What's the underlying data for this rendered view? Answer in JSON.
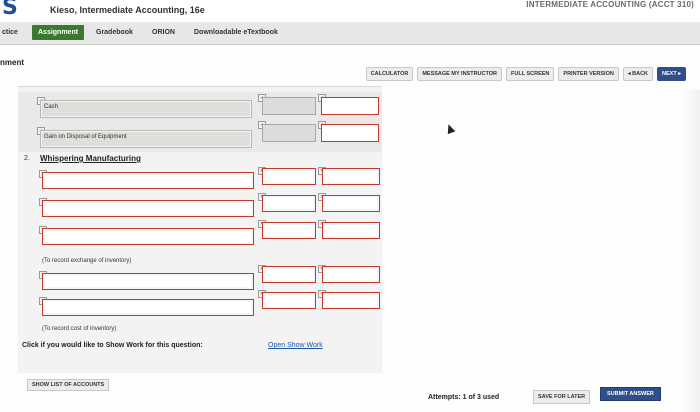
{
  "header": {
    "logo": "S",
    "course_title": "Kieso, Intermediate Accounting, 16e",
    "right_title": "INTERMEDIATE ACCOUNTING (ACCT 310)"
  },
  "nav": {
    "items": [
      "ctice",
      "Assignment",
      "Gradebook",
      "ORION",
      "Downloadable eTextbook"
    ],
    "active": "Assignment"
  },
  "section_label": "nment",
  "toolbar": {
    "calculator": "CALCULATOR",
    "message": "MESSAGE MY INSTRUCTOR",
    "full_screen": "FULL SCREEN",
    "printer": "PRINTER VERSION",
    "back": "◂ BACK",
    "next": "NEXT ▸"
  },
  "entries_top": {
    "cash": "Cash",
    "gain": "Gain on Disposal of Equipment"
  },
  "question": {
    "number": "2.",
    "title": "Whispering Manufacturing"
  },
  "notes": {
    "exchange": "(To record exchange of inventory)",
    "cost": "(To record cost of inventory)"
  },
  "show_work": {
    "prompt": "Click if you would like to Show Work for this question:",
    "link": "Open Show Work"
  },
  "footer": {
    "show_list": "SHOW LIST OF ACCOUNTS",
    "attempts": "Attempts: 1 of 3 used",
    "save_later": "SAVE FOR LATER",
    "submit": "SUBMIT ANSWER"
  }
}
